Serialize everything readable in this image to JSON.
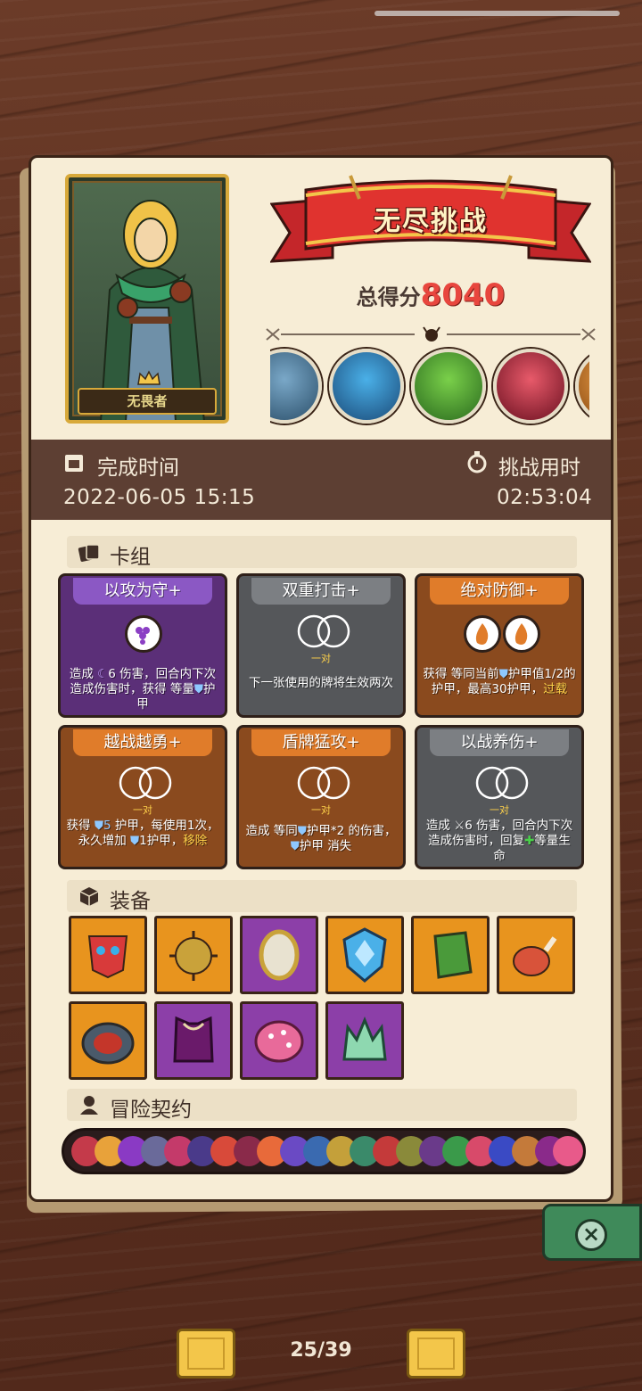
{
  "hero": {
    "name": "无畏者"
  },
  "banner": {
    "title": "无尽挑战"
  },
  "score": {
    "label": "总得分",
    "value": "8040"
  },
  "info": {
    "finish_label": "完成时间",
    "finish_value": "2022-06-05 15:15",
    "duration_label": "挑战用时",
    "duration_value": "02:53:04"
  },
  "sections": {
    "deck": "卡组",
    "equipment": "装备",
    "contract": "冒险契约"
  },
  "cards": [
    {
      "name": "以攻为守+",
      "sub": "",
      "desc_parts": [
        "造成 ",
        "6",
        " 伤害，回合内下次造成伤害时，获得 等量",
        "护甲"
      ]
    },
    {
      "name": "双重打击+",
      "sub": "一对",
      "desc": "下一张使用的牌将生效两次"
    },
    {
      "name": "绝对防御+",
      "sub": "",
      "desc_a": "获得 等同当前",
      "desc_b": "护甲值1/2的护甲，最高30护甲，",
      "desc_hl": "过载"
    },
    {
      "name": "越战越勇+",
      "sub": "一对",
      "desc_a": "获得 ",
      "desc_num": "5",
      "desc_b": " 护甲，每使用1次，永久增加 ",
      "desc_c": "1护甲，",
      "desc_hl": "移除"
    },
    {
      "name": "盾牌猛攻+",
      "sub": "一对",
      "desc_a": "造成 等同",
      "desc_b": "护甲*2 的伤害，",
      "desc_c": "护甲 消失"
    },
    {
      "name": "以战养伤+",
      "sub": "一对",
      "desc_a": "造成 ",
      "desc_num": "6",
      "desc_b": " 伤害，回合内下次造成伤害时，回复",
      "desc_c": "等量生命"
    }
  ],
  "pager": {
    "text": "25/39"
  },
  "colors": {
    "score_red": "#e8463e",
    "band": "#5d3f33",
    "board": "#f7edd6"
  }
}
